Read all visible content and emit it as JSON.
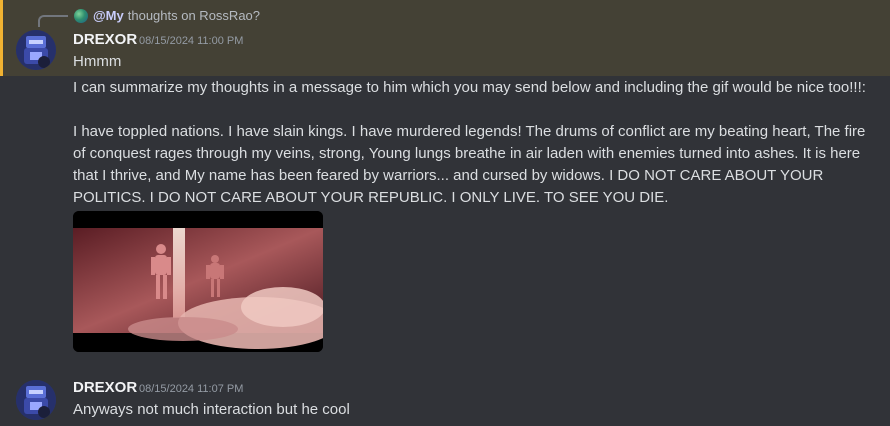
{
  "reply": {
    "mention": "@My",
    "text": "thoughts on RossRao?"
  },
  "messages": [
    {
      "username": "DREXOR",
      "timestamp": "08/15/2024 11:00 PM",
      "lines": [
        "Hmmm",
        "I can summarize my thoughts in a message to him which you may send below and including the gif would be nice too!!!:",
        "I have toppled nations. I have slain kings. I have murdered legends! The drums of conflict are my beating heart, The fire of conquest rages through my veins, strong, Young lungs breathe in air laden with enemies turned into ashes. It is here that I thrive, and My name has been feared by warriors... and cursed by widows. I DO NOT CARE ABOUT YOUR POLITICS. I DO NOT CARE ABOUT YOUR REPUBLIC. I ONLY LIVE. TO SEE YOU DIE."
      ]
    },
    {
      "username": "DREXOR",
      "timestamp": "08/15/2024 11:07 PM",
      "lines": [
        "Anyways not much interaction but he cool"
      ]
    }
  ],
  "colors": {
    "background": "#313338",
    "highlight": "#444135",
    "highlight_bar": "#f0b232",
    "username": "#f2f3f5",
    "timestamp": "#949ba4",
    "mention": "#c9cdfb"
  },
  "icons": {
    "avatar": "robot-avatar",
    "reply_avatar": "globe-avatar"
  }
}
